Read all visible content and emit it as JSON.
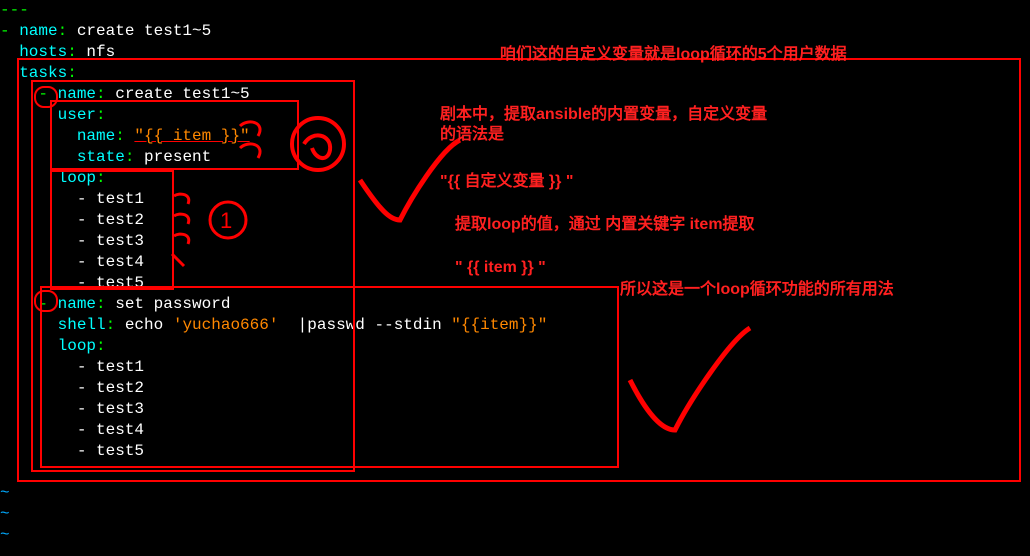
{
  "line00": "---",
  "line01_dash": "- ",
  "line01_key": "name",
  "line01_colon": ": ",
  "line01_val": "create test1~5",
  "line02_indent": "  ",
  "line02_key": "hosts",
  "line02_colon": ": ",
  "line02_val": "nfs",
  "line03_indent": "  ",
  "line03_key": "tasks",
  "line03_colon": ":",
  "line04_indent": "    ",
  "line04_dash": "- ",
  "line04_key": "name",
  "line04_colon": ": ",
  "line04_val": "create test1~5",
  "line05_indent": "      ",
  "line05_key": "user",
  "line05_colon": ":",
  "line06_indent": "        ",
  "line06_key": "name",
  "line06_colon": ": ",
  "line06_val": "\"{{ item }}\"",
  "line07_indent": "        ",
  "line07_key": "state",
  "line07_colon": ": ",
  "line07_val": "present",
  "line08_indent": "      ",
  "line08_key": "loop",
  "line08_colon": ":",
  "line09": "        - test1",
  "line10": "        - test2",
  "line11": "        - test3",
  "line12": "        - test4",
  "line13": "        - test5",
  "line14_indent": "    ",
  "line14_dash": "- ",
  "line14_key": "name",
  "line14_colon": ": ",
  "line14_val": "set password",
  "line15_indent": "      ",
  "line15_key": "shell",
  "line15_colon": ": ",
  "line15_pre": "echo ",
  "line15_str": "'yuchao666'",
  "line15_mid": "  |passwd --stdin ",
  "line15_item": "\"{{item}}\"",
  "line16_indent": "      ",
  "line16_key": "loop",
  "line16_colon": ":",
  "line17": "        - test1",
  "line18": "        - test2",
  "line19": "        - test3",
  "line20": "        - test4",
  "line21": "        - test5",
  "tilde": "~",
  "anno1": "咱们这的自定义变量就是loop循环的5个用户数据",
  "anno2a": "剧本中，提取ansible的内置变量，自定义变量",
  "anno2b": "的语法是",
  "anno3": "\"{{  自定义变量   }} \"",
  "anno4": "提取loop的值，通过 内置关键字 item提取",
  "anno5": "\" {{ item }} \"",
  "anno6": "所以这是一个loop循环功能的所有用法"
}
